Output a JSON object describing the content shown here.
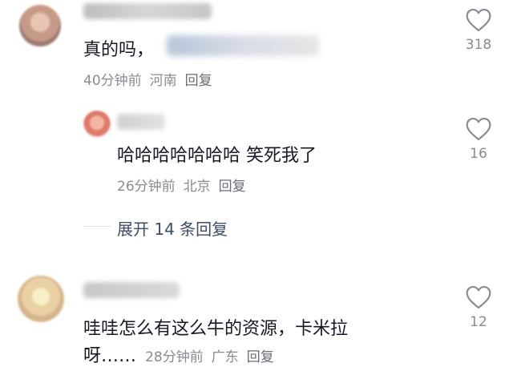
{
  "comments": [
    {
      "text": "真的吗，",
      "time": "40分钟前",
      "location": "河南",
      "reply_label": "回复",
      "likes": "318"
    },
    {
      "text": "哈哈哈哈哈哈哈 笑死我了",
      "time": "26分钟前",
      "location": "北京",
      "reply_label": "回复",
      "likes": "16"
    },
    {
      "text_line1": "哇哇怎么有这么牛的资源，卡米拉",
      "text_line2": "呀……",
      "time": "28分钟前",
      "location": "广东",
      "reply_label": "回复",
      "likes": "12"
    }
  ],
  "expand_replies_label": "展开 14 条回复",
  "icons": {
    "like": "heart-outline-icon"
  },
  "colors": {
    "meta": "#8a8b91",
    "expand": "#3d4b6b",
    "text": "#161823"
  }
}
